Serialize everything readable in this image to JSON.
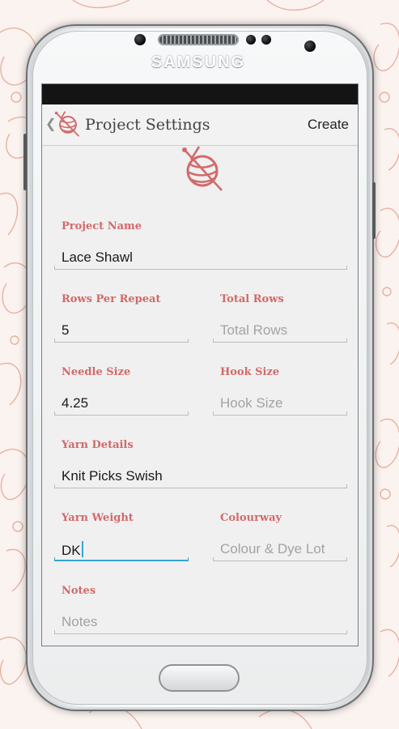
{
  "device": {
    "brand": "SAMSUNG"
  },
  "action_bar": {
    "title": "Project Settings",
    "action_label": "Create"
  },
  "fields": {
    "project_name": {
      "label": "Project Name",
      "value": "Lace Shawl",
      "placeholder": ""
    },
    "rows_per_repeat": {
      "label": "Rows Per Repeat",
      "value": "5",
      "placeholder": ""
    },
    "total_rows": {
      "label": "Total Rows",
      "value": "",
      "placeholder": "Total Rows"
    },
    "needle_size": {
      "label": "Needle Size",
      "value": "4.25",
      "placeholder": ""
    },
    "hook_size": {
      "label": "Hook Size",
      "value": "",
      "placeholder": "Hook Size"
    },
    "yarn_details": {
      "label": "Yarn Details",
      "value": "Knit Picks Swish",
      "placeholder": ""
    },
    "yarn_weight": {
      "label": "Yarn Weight",
      "value": "DK",
      "placeholder": ""
    },
    "colourway": {
      "label": "Colourway",
      "value": "",
      "placeholder": "Colour & Dye Lot"
    },
    "notes": {
      "label": "Notes",
      "value": "",
      "placeholder": "Notes"
    }
  },
  "colors": {
    "accent": "#d16a6a",
    "focus": "#33a7d2",
    "statusbar": "#141414"
  },
  "icons": {
    "app": "yarn-ball-needles-icon",
    "back": "chevron-left-icon"
  }
}
